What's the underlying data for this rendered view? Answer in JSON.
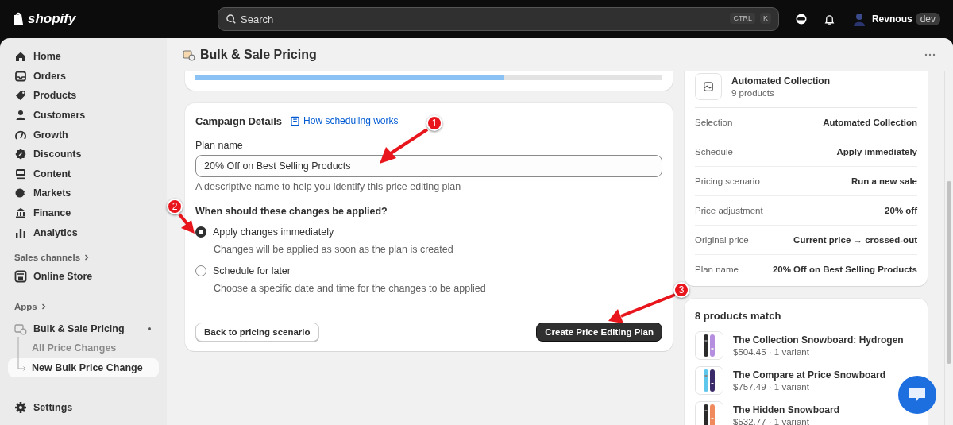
{
  "topbar": {
    "logo": "shopify",
    "search": {
      "placeholder": "Search",
      "shortcut": [
        "CTRL",
        "K"
      ]
    },
    "user": {
      "name": "Revnous",
      "badge": "dev"
    }
  },
  "sidebar": {
    "items": [
      {
        "label": "Home",
        "selected": false
      },
      {
        "label": "Orders",
        "selected": false
      },
      {
        "label": "Products",
        "selected": false
      },
      {
        "label": "Customers",
        "selected": false
      },
      {
        "label": "Growth",
        "selected": false
      },
      {
        "label": "Discounts",
        "selected": false
      },
      {
        "label": "Content",
        "selected": false
      },
      {
        "label": "Markets",
        "selected": false
      },
      {
        "label": "Finance",
        "selected": false
      },
      {
        "label": "Analytics",
        "selected": false
      }
    ],
    "sales_channels": {
      "heading": "Sales channels",
      "items": [
        {
          "label": "Online Store",
          "selected": false
        }
      ]
    },
    "apps": {
      "heading": "Apps",
      "items": [
        {
          "label": "Bulk & Sale Pricing",
          "selected": false,
          "children": [
            {
              "label": "All Price Changes",
              "selected": false
            },
            {
              "label": "New Bulk Price Change",
              "selected": true
            }
          ]
        }
      ]
    },
    "settings": {
      "label": "Settings",
      "selected": false
    }
  },
  "page": {
    "title": "Bulk & Sale Pricing"
  },
  "progress": {
    "level": 0.66
  },
  "campaign": {
    "title": "Campaign Details",
    "help_link": "How scheduling works",
    "plan_name": {
      "label": "Plan name",
      "value": "20% Off on Best Selling Products",
      "hint": "A descriptive name to help you identify this price editing plan"
    },
    "schedule": {
      "question": "When should these changes be applied?",
      "options": [
        {
          "label": "Apply changes immediately",
          "description": "Changes will be applied as soon as the plan is created",
          "selected": true
        },
        {
          "label": "Schedule for later",
          "description": "Choose a specific date and time for the changes to be applied",
          "selected": false
        }
      ]
    },
    "back_button": "Back to pricing scenario",
    "create_button": "Create Price Editing Plan"
  },
  "summary": {
    "collection": {
      "name": "Automated Collection",
      "count": "9 products"
    },
    "rows": [
      {
        "label": "Selection",
        "value": "Automated Collection"
      },
      {
        "label": "Schedule",
        "value": "Apply immediately"
      },
      {
        "label": "Pricing scenario",
        "value": "Run a new sale"
      },
      {
        "label": "Price adjustment",
        "value": "20% off"
      },
      {
        "label": "Original price",
        "value": "Current price → crossed-out"
      },
      {
        "label": "Plan name",
        "value": "20% Off on Best Selling Products"
      }
    ]
  },
  "matches": {
    "title": "8 products match",
    "products": [
      {
        "name": "The Collection Snowboard: Hydrogen",
        "details": "$504.45 · 1 variant"
      },
      {
        "name": "The Compare at Price Snowboard",
        "details": "$757.49 · 1 variant"
      },
      {
        "name": "The Hidden Snowboard",
        "details": "$532.77 · 1 variant"
      }
    ]
  },
  "annotations": [
    {
      "number": "1"
    },
    {
      "number": "2"
    },
    {
      "number": "3"
    }
  ]
}
